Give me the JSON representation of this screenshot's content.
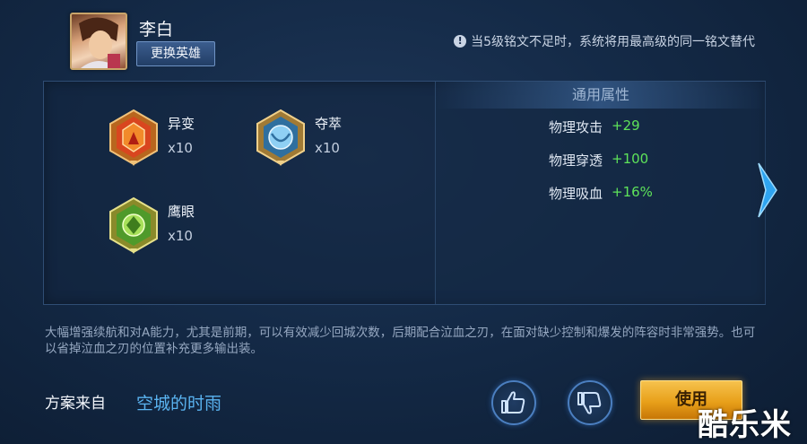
{
  "hero": {
    "name": "李白",
    "change_label": "更换英雄"
  },
  "notice": {
    "icon": "info-icon",
    "text": "当5级铭文不足时，系统将用最高级的同一铭文替代"
  },
  "runes": [
    {
      "name": "异变",
      "count": "x10",
      "color": "#e0702a",
      "icon": "rune-red-icon"
    },
    {
      "name": "夺萃",
      "count": "x10",
      "color": "#6fb6e8",
      "icon": "rune-blue-icon"
    },
    {
      "name": "鹰眼",
      "count": "x10",
      "color": "#7cc13b",
      "icon": "rune-green-icon"
    }
  ],
  "attributes": {
    "header": "通用属性",
    "items": [
      {
        "label": "物理攻击",
        "value": "+29"
      },
      {
        "label": "物理穿透",
        "value": "+100"
      },
      {
        "label": "物理吸血",
        "value": "+16%"
      }
    ]
  },
  "description": "大幅增强续航和对A能力，尤其是前期，可以有效减少回城次数，后期配合泣血之刃，在面对缺少控制和爆发的阵容时非常强势。也可以省掉泣血之刃的位置补充更多输出装。",
  "source": {
    "label": "方案来自",
    "author": "空城的时雨"
  },
  "actions": {
    "use_label": "使用"
  },
  "watermark": "酷乐米",
  "colors": {
    "accent": "#5ab3f0",
    "positive": "#5ee35a",
    "gold": "#e8a01a"
  }
}
